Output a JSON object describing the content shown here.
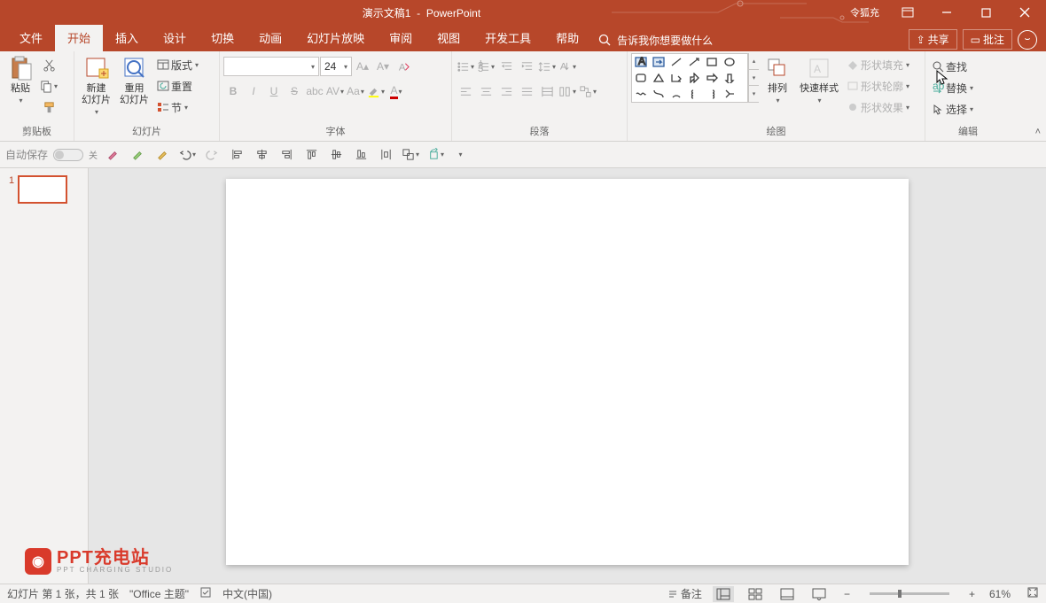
{
  "title_doc": "演示文稿1",
  "title_app": "PowerPoint",
  "account": "令狐充",
  "tabs": [
    "文件",
    "开始",
    "插入",
    "设计",
    "切换",
    "动画",
    "幻灯片放映",
    "审阅",
    "视图",
    "开发工具",
    "帮助"
  ],
  "active_tab": 1,
  "search_placeholder": "告诉我你想要做什么",
  "share": "共享",
  "comment": "批注",
  "groups": {
    "clipboard": {
      "label": "剪贴板",
      "paste": "粘贴"
    },
    "slides": {
      "label": "幻灯片",
      "new": "新建\n幻灯片",
      "reuse": "重用\n幻灯片",
      "layout": "版式",
      "reset": "重置",
      "section": "节"
    },
    "font": {
      "label": "字体",
      "size": "24"
    },
    "paragraph": {
      "label": "段落"
    },
    "drawing": {
      "label": "绘图",
      "arrange": "排列",
      "quick": "快速样式",
      "fill": "形状填充",
      "outline": "形状轮廓",
      "effects": "形状效果"
    },
    "editing": {
      "label": "编辑",
      "find": "查找",
      "replace": "替换",
      "select": "选择"
    }
  },
  "qat_autosave": "自动保存",
  "qat_off": "关",
  "thumb_num": "1",
  "watermark_main": "PPT充电站",
  "watermark_sub": "PPT CHARGING STUDIO",
  "status": {
    "slide": "幻灯片 第 1 张，共 1 张",
    "theme": "\"Office 主题\"",
    "lang": "中文(中国)",
    "notes": "备注",
    "zoom": "61%"
  }
}
